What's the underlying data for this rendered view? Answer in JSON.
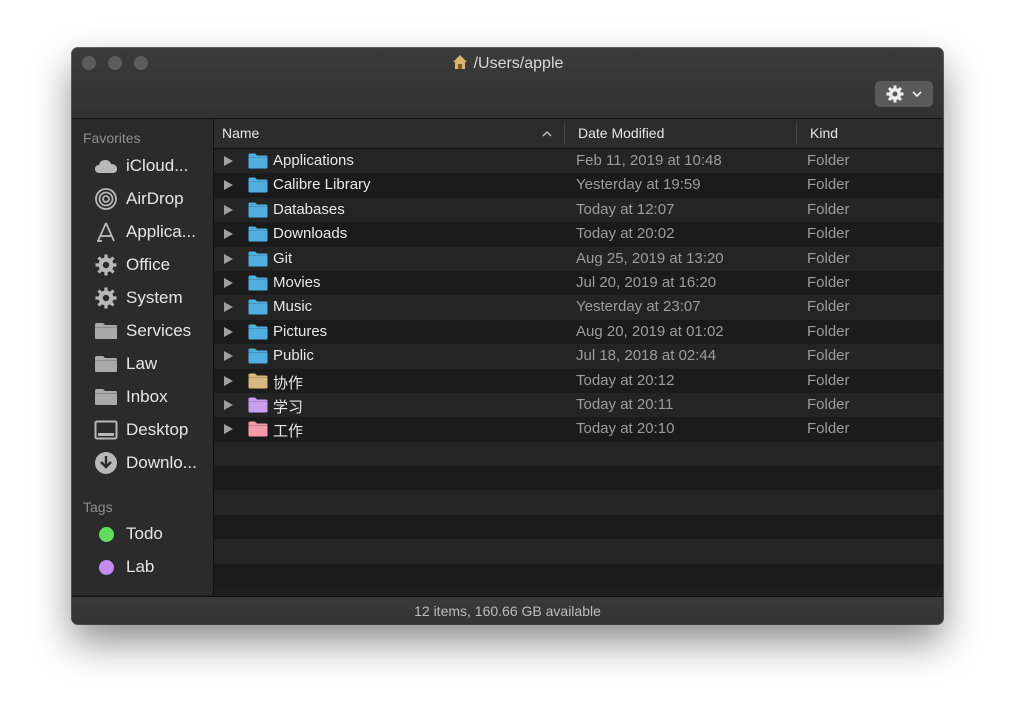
{
  "window": {
    "title": "/Users/apple",
    "status_text": "12 items, 160.66 GB available"
  },
  "sidebar": {
    "favorites_label": "Favorites",
    "tags_label": "Tags",
    "favorites": [
      {
        "label": "iCloud...",
        "icon": "cloud-icon"
      },
      {
        "label": "AirDrop",
        "icon": "airdrop-icon"
      },
      {
        "label": "Applica...",
        "icon": "applications-icon"
      },
      {
        "label": "Office",
        "icon": "gear-icon"
      },
      {
        "label": "System",
        "icon": "gear-icon"
      },
      {
        "label": "Services",
        "icon": "folder-icon"
      },
      {
        "label": "Law",
        "icon": "folder-icon"
      },
      {
        "label": "Inbox",
        "icon": "folder-icon"
      },
      {
        "label": "Desktop",
        "icon": "desktop-icon"
      },
      {
        "label": "Downlo...",
        "icon": "download-icon"
      }
    ],
    "tags": [
      {
        "label": "Todo",
        "color": "#5fdd5c"
      },
      {
        "label": "Lab",
        "color": "#c58cf3"
      }
    ]
  },
  "columns": {
    "name": "Name",
    "date_modified": "Date Modified",
    "kind": "Kind"
  },
  "files": [
    {
      "name": "Applications",
      "date": "Feb 11, 2019 at 10:48",
      "kind": "Folder",
      "color": "#4fb0e0"
    },
    {
      "name": "Calibre Library",
      "date": "Yesterday at 19:59",
      "kind": "Folder",
      "color": "#4fb0e0"
    },
    {
      "name": "Databases",
      "date": "Today at 12:07",
      "kind": "Folder",
      "color": "#4fb0e0"
    },
    {
      "name": "Downloads",
      "date": "Today at 20:02",
      "kind": "Folder",
      "color": "#4fb0e0"
    },
    {
      "name": "Git",
      "date": "Aug 25, 2019 at 13:20",
      "kind": "Folder",
      "color": "#4fb0e0"
    },
    {
      "name": "Movies",
      "date": "Jul 20, 2019 at 16:20",
      "kind": "Folder",
      "color": "#4fb0e0"
    },
    {
      "name": "Music",
      "date": "Yesterday at 23:07",
      "kind": "Folder",
      "color": "#4fb0e0"
    },
    {
      "name": "Pictures",
      "date": "Aug 20, 2019 at 01:02",
      "kind": "Folder",
      "color": "#4fb0e0"
    },
    {
      "name": "Public",
      "date": "Jul 18, 2018 at 02:44",
      "kind": "Folder",
      "color": "#4fb0e0"
    },
    {
      "name": "协作",
      "date": "Today at 20:12",
      "kind": "Folder",
      "color": "#d8b880"
    },
    {
      "name": "学习",
      "date": "Today at 20:11",
      "kind": "Folder",
      "color": "#c9a0f0"
    },
    {
      "name": "工作",
      "date": "Today at 20:10",
      "kind": "Folder",
      "color": "#f49aa8"
    }
  ]
}
